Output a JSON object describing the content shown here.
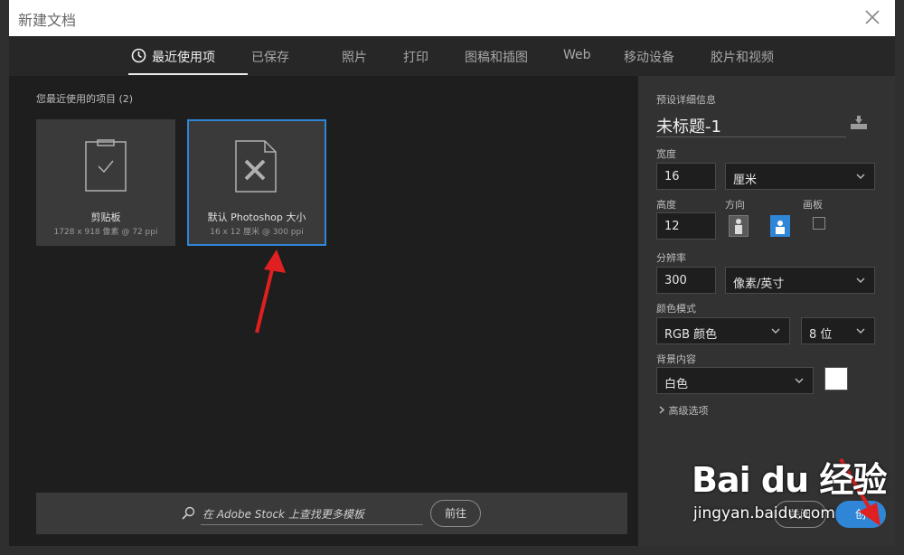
{
  "dialog": {
    "title": "新建文档"
  },
  "tabs": [
    {
      "label": "最近使用项",
      "active": true
    },
    {
      "label": "已保存"
    },
    {
      "label": "照片"
    },
    {
      "label": "打印"
    },
    {
      "label": "图稿和插图"
    },
    {
      "label": "Web"
    },
    {
      "label": "移动设备"
    },
    {
      "label": "胶片和视频"
    }
  ],
  "recent": {
    "label": "您最近使用的项目",
    "count": "(2)",
    "items": [
      {
        "name": "剪贴板",
        "meta": "1728 x 918 像素 @ 72 ppi",
        "icon": "clipboard-check-icon"
      },
      {
        "name": "默认 Photoshop 大小",
        "meta": "16 x 12 厘米 @ 300 ppi",
        "icon": "document-pencil-ruler-icon",
        "selected": true
      }
    ]
  },
  "search": {
    "placeholder": "在 Adobe Stock 上查找更多模板",
    "go_label": "前往"
  },
  "details": {
    "heading": "预设详细信息",
    "doc_name": "未标题-1",
    "width_label": "宽度",
    "width_value": "16",
    "width_unit": "厘米",
    "height_label": "高度",
    "height_value": "12",
    "orientation_label": "方向",
    "artboard_label": "画板",
    "resolution_label": "分辨率",
    "resolution_value": "300",
    "resolution_unit": "像素/英寸",
    "color_mode_label": "颜色模式",
    "color_mode_value": "RGB 颜色",
    "bit_depth_value": "8 位",
    "background_label": "背景内容",
    "background_value": "白色",
    "advanced_label": "高级选项",
    "close_label": "关闭",
    "create_label": "创"
  },
  "watermark": {
    "main": "Bai du 经验",
    "url": "jingyan.baidu.com"
  },
  "colors": {
    "accent": "#2f86d6",
    "arrow": "#e02020"
  }
}
